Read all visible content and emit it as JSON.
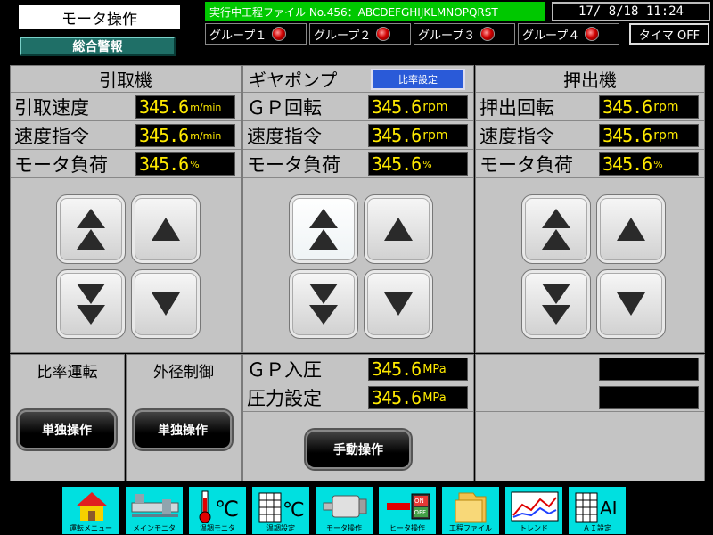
{
  "header": {
    "title": "モータ操作",
    "alarm_label": "総合警報",
    "file_label": "実行中工程ファイル No.456：ABCDEFGHIJKLMNOPQRST",
    "datetime": "17/ 8/18 11:24",
    "groups": [
      "グループ１",
      "グループ２",
      "グループ３",
      "グループ４"
    ],
    "timer_label": "タイマ OFF"
  },
  "puller": {
    "title": "引取機",
    "rows": [
      {
        "label": "引取速度",
        "value": "345.6",
        "unit": "m/min"
      },
      {
        "label": "速度指令",
        "value": "345.6",
        "unit": "m/min"
      },
      {
        "label": "モータ負荷",
        "value": "345.6",
        "unit": "%"
      }
    ]
  },
  "gear_pump": {
    "title": "ギヤポンプ",
    "ratio_button": "比率設定",
    "rows": [
      {
        "label": "ＧＰ回転",
        "value": "345.6",
        "unit": "rpm"
      },
      {
        "label": "速度指令",
        "value": "345.6",
        "unit": "rpm"
      },
      {
        "label": "モータ負荷",
        "value": "345.6",
        "unit": "%"
      }
    ]
  },
  "extruder": {
    "title": "押出機",
    "rows": [
      {
        "label": "押出回転",
        "value": "345.6",
        "unit": "rpm"
      },
      {
        "label": "速度指令",
        "value": "345.6",
        "unit": "rpm"
      },
      {
        "label": "モータ負荷",
        "value": "345.6",
        "unit": "%"
      }
    ]
  },
  "lower": {
    "ratio_label": "比率運転",
    "od_label": "外径制御",
    "solo_button_1": "単独操作",
    "solo_button_2": "単独操作",
    "gp_pressure_label": "ＧＰ入圧",
    "gp_pressure_value": "345.6",
    "gp_pressure_unit": "MPa",
    "pressure_set_label": "圧力設定",
    "pressure_set_value": "345.6",
    "pressure_set_unit": "MPa",
    "manual_button": "手動操作"
  },
  "nav": {
    "items": [
      "運転メニュー",
      "メインモニタ",
      "温調モニタ",
      "温調設定",
      "モータ操作",
      "ヒータ操作",
      "工程ファイル",
      "トレンド",
      "ＡＩ設定"
    ],
    "icons": [
      "house-icon",
      "extruder-icon",
      "thermometer-icon",
      "temp-grid-icon",
      "motor-icon",
      "heater-switch-icon",
      "folder-icon",
      "trend-chart-icon",
      "ai-grid-icon"
    ],
    "celsius": "℃",
    "ai_text": "AI",
    "switch_on": "ON",
    "switch_off": "OFF"
  },
  "colors": {
    "panel_bg": "#c4c4c4",
    "value_text": "#ffea00",
    "file_bar": "#00c800",
    "nav_bg": "#00e0e0",
    "alarm_bg": "#1f6f67"
  }
}
